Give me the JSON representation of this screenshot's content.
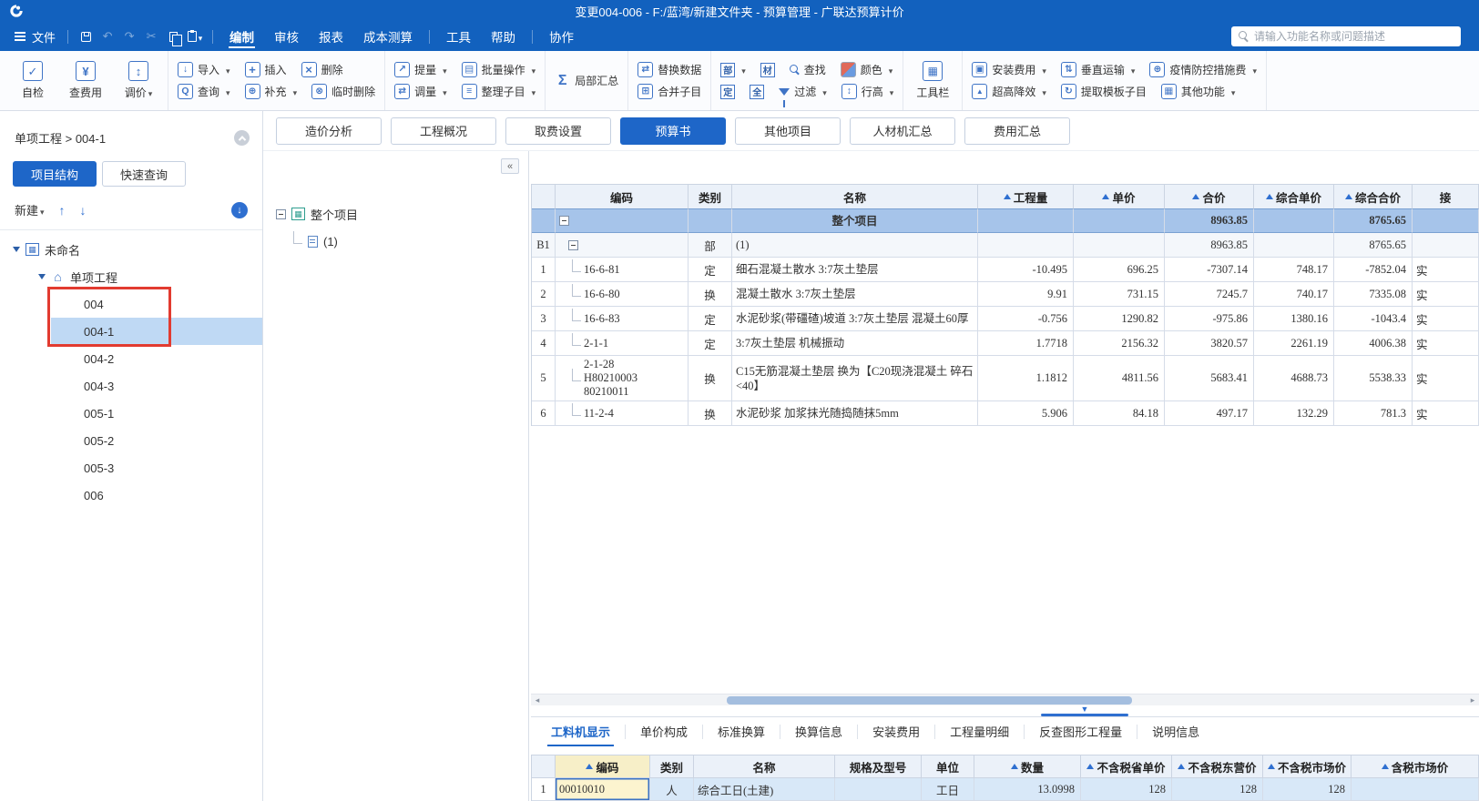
{
  "title_bar": {
    "title": "变更004-006 - F:/蓝湾/新建文件夹 - 预算管理 - 广联达预算计价"
  },
  "menu_bar": {
    "file": "文件",
    "menus": [
      "编制",
      "审核",
      "报表",
      "成本测算",
      "工具",
      "帮助",
      "协作"
    ],
    "active_menu": "编制",
    "search_placeholder": "请输入功能名称或问题描述"
  },
  "toolbar": {
    "self_check": "自检",
    "check_cost": "查费用",
    "adjust_price": "调价",
    "import": "导入",
    "insert": "插入",
    "delete": "删除",
    "query": "查询",
    "supplement": "补充",
    "temp_delete": "临时删除",
    "extract_qty": "提量",
    "batch_ops": "批量操作",
    "adjust_qty": "调量",
    "organize_items": "整理子目",
    "partial_summary": "局部汇总",
    "replace_data": "替换数据",
    "merge_items": "合并子目",
    "view_bu": "部",
    "view_cai": "材",
    "view_ding": "定",
    "view_quan": "全",
    "find": "查找",
    "filter": "过滤",
    "color": "颜色",
    "row_height": "行高",
    "toolbar_panel": "工具栏",
    "install_fee": "安装费用",
    "super_high": "超高降效",
    "vertical_transport": "垂直运输",
    "extract_template": "提取模板子目",
    "epidemic_fee": "疫情防控措施费",
    "other_functions": "其他功能"
  },
  "sidebar": {
    "breadcrumb": "单项工程 > 004-1",
    "tab_structure": "项目结构",
    "tab_quick": "快速查询",
    "new_button": "新建",
    "tree": {
      "root": "未命名",
      "project": "单项工程",
      "items": [
        "004",
        "004-1",
        "004-2",
        "004-3",
        "005-1",
        "005-2",
        "005-3",
        "006"
      ],
      "selected": "004-1"
    }
  },
  "middle_tree": {
    "root": "整个项目",
    "child": "(1)"
  },
  "doc_tabs": {
    "items": [
      "造价分析",
      "工程概况",
      "取费设置",
      "预算书",
      "其他项目",
      "人材机汇总",
      "费用汇总"
    ],
    "active": "预算书"
  },
  "main_table": {
    "headers": [
      "编码",
      "类别",
      "名称",
      "工程量",
      "单价",
      "合价",
      "综合单价",
      "综合合价",
      "接"
    ],
    "rows": [
      {
        "num": "",
        "code": "",
        "cat": "",
        "name": "整个项目",
        "qty": "",
        "price": "",
        "total": "8963.85",
        "comp_price": "",
        "comp_total": "8765.65",
        "tail": ""
      },
      {
        "num": "B1",
        "code": "",
        "cat": "部",
        "name": "(1)",
        "qty": "",
        "price": "",
        "total": "8963.85",
        "comp_price": "",
        "comp_total": "8765.65",
        "tail": ""
      },
      {
        "num": "1",
        "code": "16-6-81",
        "cat": "定",
        "name": "细石混凝土散水 3:7灰土垫层",
        "qty": "-10.495",
        "price": "696.25",
        "total": "-7307.14",
        "comp_price": "748.17",
        "comp_total": "-7852.04",
        "tail": "实"
      },
      {
        "num": "2",
        "code": "16-6-80",
        "cat": "换",
        "name": "混凝土散水 3:7灰土垫层",
        "qty": "9.91",
        "price": "731.15",
        "total": "7245.7",
        "comp_price": "740.17",
        "comp_total": "7335.08",
        "tail": "实"
      },
      {
        "num": "3",
        "code": "16-6-83",
        "cat": "定",
        "name": "水泥砂浆(带礓碴)坡道 3:7灰土垫层 混凝土60厚",
        "qty": "-0.756",
        "price": "1290.82",
        "total": "-975.86",
        "comp_price": "1380.16",
        "comp_total": "-1043.4",
        "tail": "实"
      },
      {
        "num": "4",
        "code": "2-1-1",
        "cat": "定",
        "name": "3:7灰土垫层 机械振动",
        "qty": "1.7718",
        "price": "2156.32",
        "total": "3820.57",
        "comp_price": "2261.19",
        "comp_total": "4006.38",
        "tail": "实"
      },
      {
        "num": "5",
        "code": "2-1-28\nH80210003\n80210011",
        "cat": "换",
        "name": "C15无筋混凝土垫层  换为【C20现浇混凝土 碎石<40】",
        "qty": "1.1812",
        "price": "4811.56",
        "total": "5683.41",
        "comp_price": "4688.73",
        "comp_total": "5538.33",
        "tail": "实"
      },
      {
        "num": "6",
        "code": "11-2-4",
        "cat": "换",
        "name": "水泥砂浆 加浆抹光随捣随抹5mm",
        "qty": "5.906",
        "price": "84.18",
        "total": "497.17",
        "comp_price": "132.29",
        "comp_total": "781.3",
        "tail": "实"
      }
    ]
  },
  "bottom_panel": {
    "tabs": [
      "工料机显示",
      "单价构成",
      "标准换算",
      "换算信息",
      "安装费用",
      "工程量明细",
      "反查图形工程量",
      "说明信息"
    ],
    "active_tab": "工料机显示",
    "headers": [
      "编码",
      "类别",
      "名称",
      "规格及型号",
      "单位",
      "数量",
      "不含税省单价",
      "不含税东营价",
      "不含税市场价",
      "含税市场价"
    ],
    "rows": [
      {
        "num": "1",
        "code": "00010010",
        "cat": "人",
        "name": "综合工日(土建)",
        "spec": "",
        "unit": "工日",
        "qty": "13.0998",
        "province_price": "128",
        "dongying_price": "128",
        "market_price": "128",
        "taxed_price": ""
      }
    ]
  }
}
